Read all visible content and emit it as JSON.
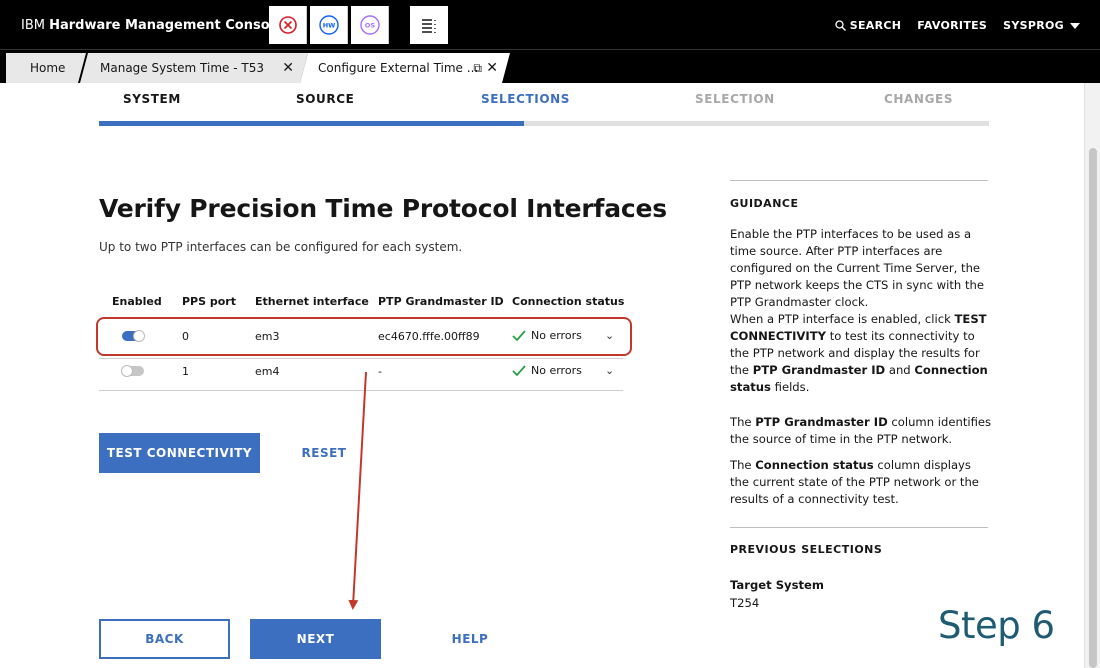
{
  "header": {
    "brand_prefix": "IBM",
    "brand_name": "Hardware Management Console",
    "search_label": "SEARCH",
    "favorites_label": "FAVORITES",
    "user_label": "SYSPROG",
    "hw_badge": "HW",
    "os_badge": "OS"
  },
  "tabs": [
    {
      "label": "Home"
    },
    {
      "label": "Manage System Time - T53"
    },
    {
      "label": "Configure External Time ..."
    }
  ],
  "wizard": {
    "steps": [
      "SYSTEM",
      "SOURCE",
      "SELECTIONS",
      "SELECTION",
      "CHANGES"
    ],
    "active_index": 2,
    "progress": 0.477
  },
  "main": {
    "title": "Verify Precision Time Protocol Interfaces",
    "subtitle": "Up to two PTP interfaces can be configured for each system.",
    "table": {
      "columns": [
        "Enabled",
        "PPS port",
        "Ethernet interface",
        "PTP Grandmaster ID",
        "Connection status"
      ],
      "rows": [
        {
          "enabled": true,
          "pps_port": "0",
          "ethernet": "em3",
          "grandmaster": "ec4670.fffe.00ff89",
          "status": "No errors"
        },
        {
          "enabled": false,
          "pps_port": "1",
          "ethernet": "em4",
          "grandmaster": "-",
          "status": "No errors"
        }
      ]
    },
    "test_button": "TEST CONNECTIVITY",
    "reset_button": "RESET",
    "back_button": "BACK",
    "next_button": "NEXT",
    "help_button": "HELP"
  },
  "guidance": {
    "heading": "GUIDANCE",
    "previous_heading": "PREVIOUS SELECTIONS",
    "target_label": "Target System",
    "target_value": "T254"
  },
  "annotation": {
    "step_label": "Step 6"
  },
  "colors": {
    "accent": "#3c6fc0",
    "highlight": "#c0392b",
    "success": "#24a148"
  }
}
